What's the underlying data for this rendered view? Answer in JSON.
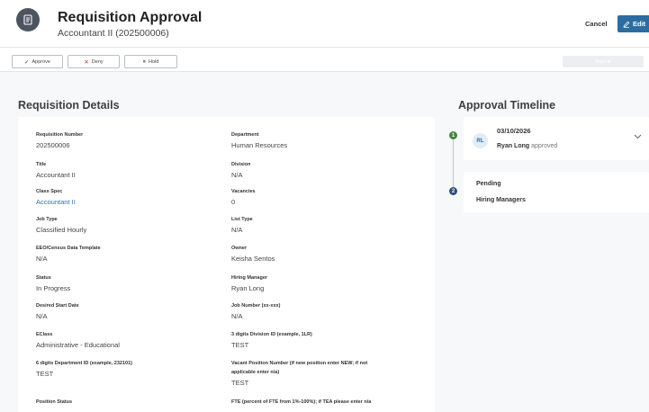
{
  "header": {
    "title": "Requisition Approval",
    "subtitle": "Accountant II (202500006)",
    "cancel_label": "Cancel",
    "edit_label": "Edit",
    "accent_color": "#2b6da0"
  },
  "actions": {
    "approve_label": "Approve",
    "deny_label": "Deny",
    "hold_label": "Hold",
    "submit_label": "Submit"
  },
  "details": {
    "title": "Requisition Details",
    "fields": [
      {
        "label": "Requisition Number",
        "value": "202500006"
      },
      {
        "label": "Department",
        "value": "Human Resources"
      },
      {
        "label": "Title",
        "value": "Accountant II"
      },
      {
        "label": "Division",
        "value": "N/A"
      },
      {
        "label": "Class Spec",
        "value": "Accountant II"
      },
      {
        "label": "Vacancies",
        "value": "0"
      },
      {
        "label": "Job Type",
        "value": "Classified Hourly"
      },
      {
        "label": "List Type",
        "value": "N/A"
      },
      {
        "label": "EEO/Census Data Template",
        "value": "N/A"
      },
      {
        "label": "Owner",
        "value": "Keisha Sentos"
      },
      {
        "label": "Status",
        "value": "In Progress"
      },
      {
        "label": "Hiring Manager",
        "value": "Ryan Long"
      },
      {
        "label": "Desired Start Date",
        "value": "N/A"
      },
      {
        "label": "Job Number (xx-xxx)",
        "value": "N/A"
      },
      {
        "label": "EClass",
        "value": "Administrative - Educational"
      },
      {
        "label": "3 digits Division ID (example, 1LR)",
        "value": "TEST"
      },
      {
        "label": "6 digits Department ID (example, 232101)",
        "value": "TEST"
      },
      {
        "label": "Vacant Position Number (if new position enter NEW; if not",
        "label2": "applicable enter n/a)",
        "value": "TEST"
      },
      {
        "label": "Position Status",
        "value": ""
      },
      {
        "label": "FTE (percent of FTE from 1%-100%); if TEA please enter n/a",
        "value": ""
      }
    ]
  },
  "timeline": {
    "title": "Approval Timeline",
    "steps": [
      {
        "index": "1",
        "color": "#3a8a3e",
        "initials": "RL",
        "date": "03/10/2026",
        "person": "Ryan Long",
        "action": "approved"
      },
      {
        "index": "2",
        "color": "#2b4f7a",
        "status": "Pending",
        "group": "Hiring Managers"
      }
    ]
  }
}
